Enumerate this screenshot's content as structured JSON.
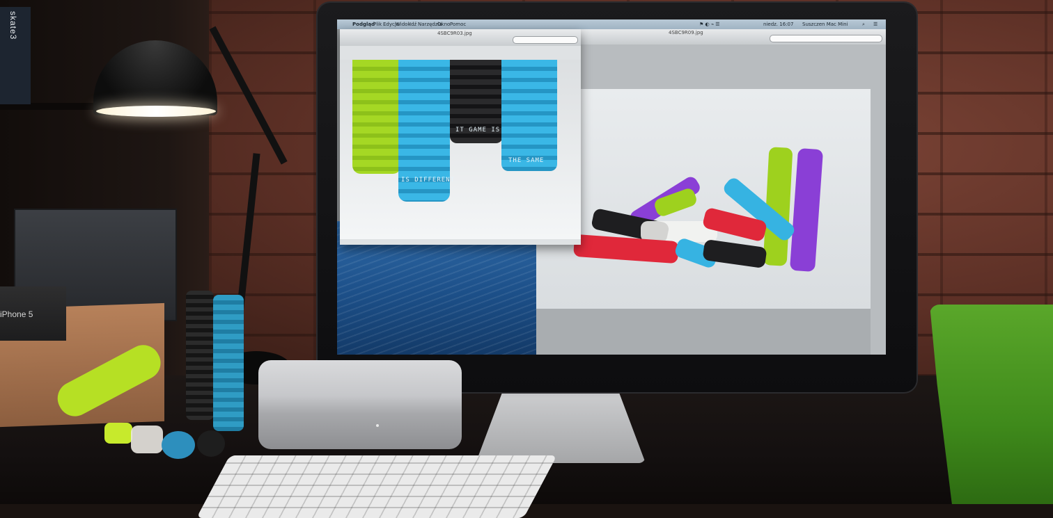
{
  "screen": {
    "menubar": {
      "apple_symbol": "",
      "app_name": "Podgląd",
      "menus": [
        "Plik",
        "Edycja",
        "Widok",
        "Idź",
        "Narzędzia",
        "Okno",
        "Pomoc"
      ],
      "clock": "niedz. 16:07",
      "user": "Suszczen Mac Mini"
    },
    "window_left": {
      "title": "4SBC9R03.jpg"
    },
    "window_right": {
      "title": "4SBC9R09.jpg"
    }
  },
  "grip_text": {
    "black_grip": "IT GAME IS",
    "blue_grip_left": "IS DIFFERENT",
    "blue_grip_right": "THE SAME"
  },
  "room": {
    "iphone_box_label": "iPhone 5",
    "game_case_label": "skate3"
  },
  "colors": {
    "grip_green": "#9ed11e",
    "grip_blue": "#36b3e2",
    "grip_black": "#1e1e20",
    "grip_purple": "#8a3fd6",
    "grip_red": "#e0283a",
    "desktop_blue": "#1f5791"
  }
}
